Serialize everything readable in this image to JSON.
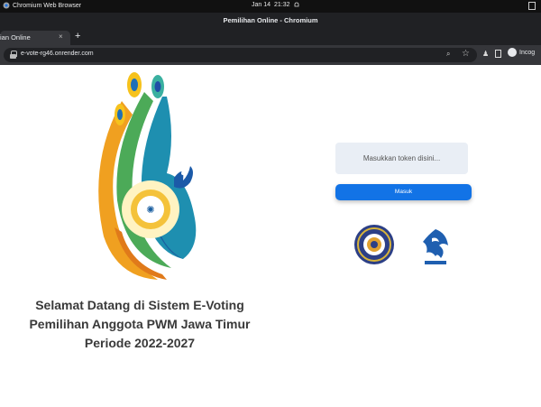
{
  "os": {
    "app_name": "Chromium Web Browser",
    "date": "Jan 14",
    "time": "21:32"
  },
  "window": {
    "title": "Pemilihan Online - Chromium"
  },
  "tab": {
    "label": "ian Online",
    "close": "×",
    "new_tab": "+"
  },
  "toolbar": {
    "url": "e-vote-rg46.onrender.com",
    "profile": "Incog"
  },
  "page": {
    "welcome_lines": [
      "Selamat Datang di Sistem E-Voting",
      "Pemilihan Anggota PWM Jawa Timur",
      "Periode 2022-2027"
    ],
    "token_placeholder": "Masukkan token disini...",
    "submit_label": "Masuk"
  },
  "colors": {
    "accent_blue": "#1273e6",
    "input_bg": "#e9eef5",
    "chrome_dark": "#202124"
  }
}
